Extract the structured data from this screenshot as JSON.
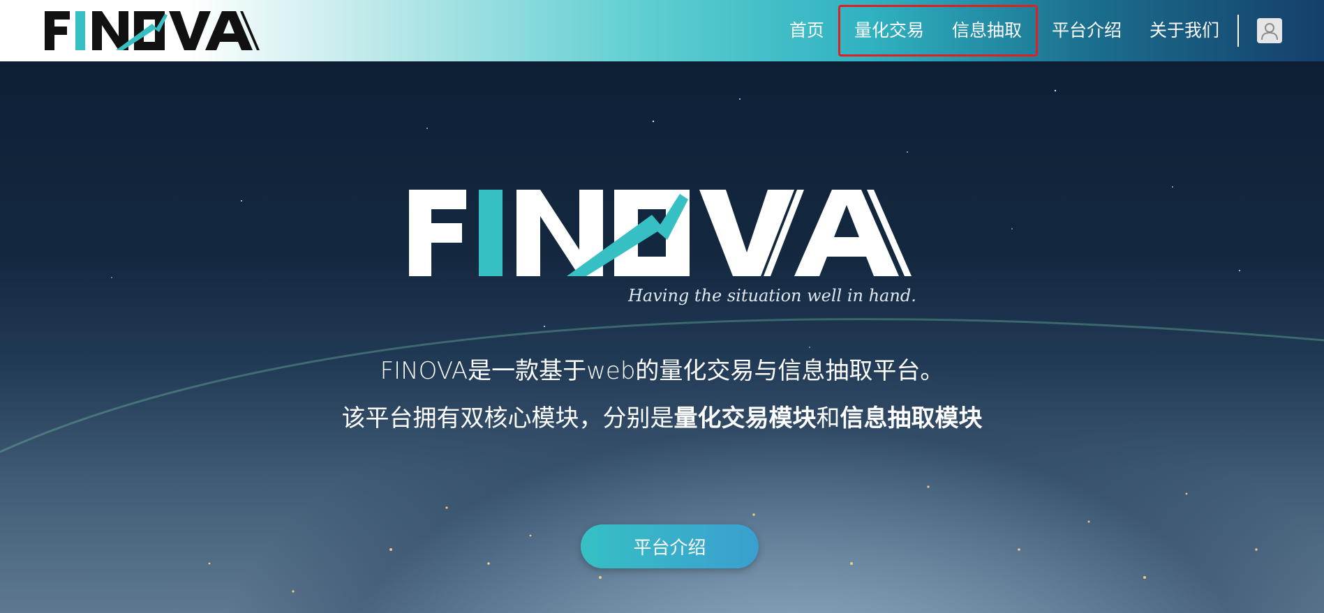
{
  "brand": {
    "name": "FINOVA",
    "slogan": "Having the situation well in hand.",
    "colors": {
      "accent": "#36C0C4",
      "dark": "#0F1F33",
      "highlight_box": "#E02020"
    }
  },
  "nav": {
    "items": [
      {
        "label": "首页"
      },
      {
        "label": "量化交易"
      },
      {
        "label": "信息抽取"
      },
      {
        "label": "平台介绍"
      },
      {
        "label": "关于我们"
      }
    ],
    "user_icon": "user-icon"
  },
  "hero": {
    "line1": "FINOVA是一款基于web的量化交易与信息抽取平台。",
    "line2_prefix": "该平台拥有双核心模块，分别是",
    "line2_bold1": "量化交易模块",
    "line2_mid": "和",
    "line2_bold2": "信息抽取模块",
    "cta_label": "平台介绍"
  }
}
